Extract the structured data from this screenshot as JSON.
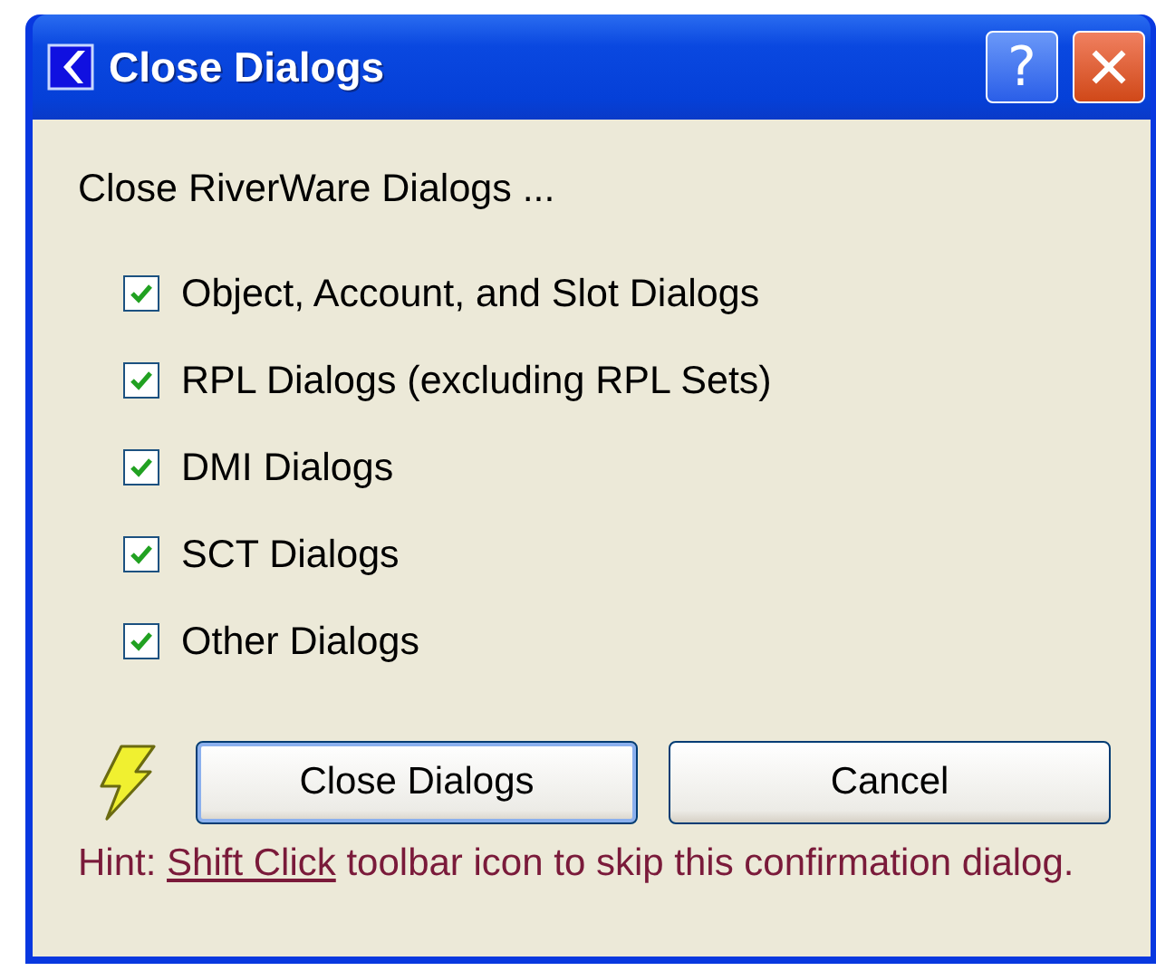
{
  "window": {
    "title": "Close Dialogs",
    "help_button": "?"
  },
  "prompt": "Close RiverWare Dialogs ...",
  "options": [
    {
      "label": "Object, Account, and Slot Dialogs",
      "checked": true
    },
    {
      "label": "RPL Dialogs (excluding RPL Sets)",
      "checked": true
    },
    {
      "label": "DMI Dialogs",
      "checked": true
    },
    {
      "label": "SCT Dialogs",
      "checked": true
    },
    {
      "label": "Other Dialogs",
      "checked": true
    }
  ],
  "buttons": [
    {
      "label": "Close Dialogs",
      "selected": true
    },
    {
      "label": "Cancel",
      "selected": false
    }
  ],
  "hint": {
    "prefix": "Hint:",
    "link": "Shift Click",
    "suffix": "toolbar icon to skip this confirmation dialog."
  }
}
